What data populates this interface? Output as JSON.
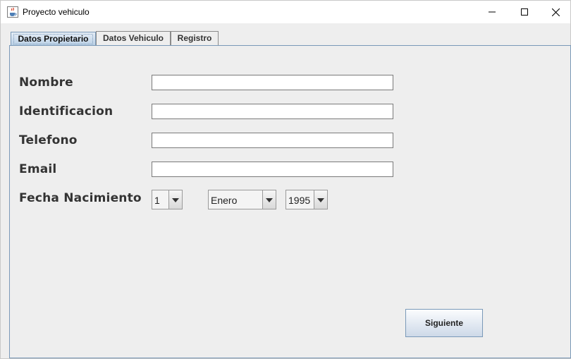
{
  "window": {
    "title": "Proyecto vehiculo",
    "icon": "java-cup-icon",
    "controls": [
      "minimize-icon",
      "maximize-icon",
      "close-icon"
    ]
  },
  "tabs": [
    {
      "label": "Datos Propietario",
      "selected": true
    },
    {
      "label": "Datos Vehiculo",
      "selected": false
    },
    {
      "label": "Registro",
      "selected": false
    }
  ],
  "form": {
    "nombre": {
      "label": "Nombre",
      "value": ""
    },
    "identificacion": {
      "label": "Identificacion",
      "value": ""
    },
    "telefono": {
      "label": "Telefono",
      "value": ""
    },
    "email": {
      "label": "Email",
      "value": ""
    },
    "fecha_nacimiento": {
      "label": "Fecha Nacimiento",
      "day": "1",
      "month": "Enero",
      "year": "1995"
    }
  },
  "buttons": {
    "next_label": "Siguiente"
  },
  "colors": {
    "accent_border": "#7a99b8",
    "background": "#eeeeee",
    "label_text": "#333333"
  }
}
